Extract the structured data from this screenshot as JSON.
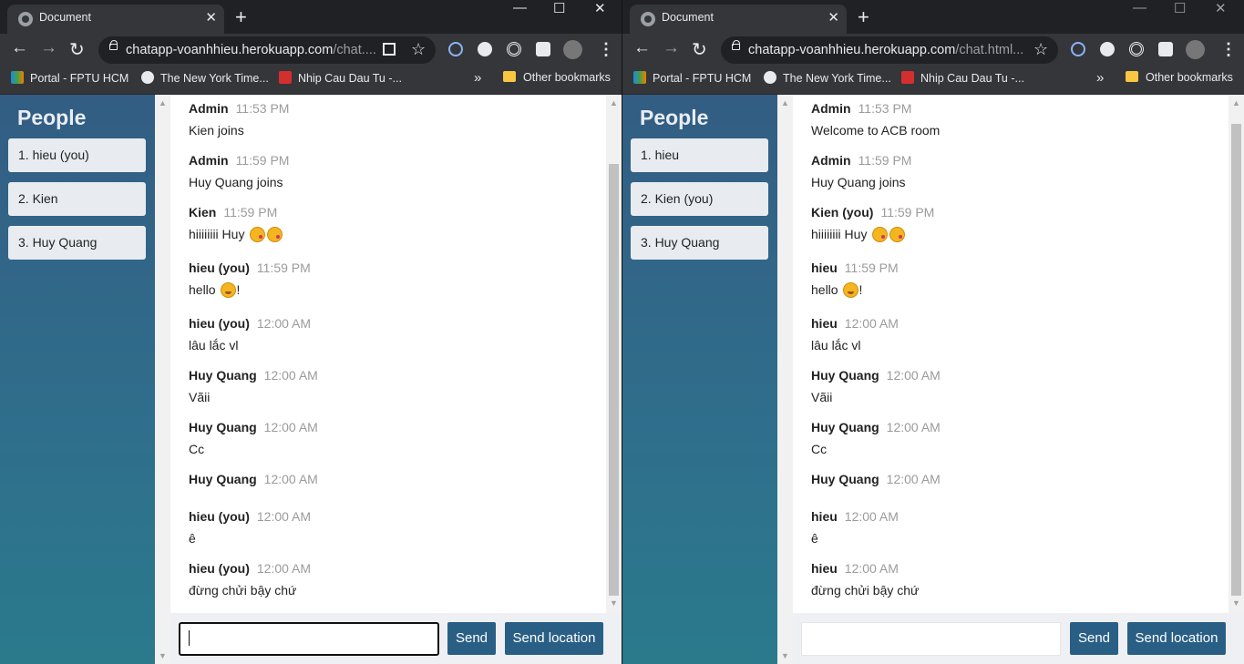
{
  "windows": [
    {
      "tab_title": "Document",
      "url_main": "chatapp-voanhhieu.herokuapp.com",
      "url_rest": "/chat....",
      "bookmarks": [
        "Portal - FPTU HCM",
        "The New York Time...",
        "Nhip Cau Dau Tu -..."
      ],
      "bookmarks_more": "»",
      "other_bookmarks": "Other bookmarks",
      "people_title": "People",
      "users": [
        "1. hieu (you)",
        "2. Kien",
        "3. Huy Quang"
      ],
      "messages": [
        {
          "name": "Admin",
          "time": "11:53 PM",
          "text": "Kien joins",
          "emoji": ""
        },
        {
          "name": "Admin",
          "time": "11:59 PM",
          "text": "Huy Quang joins",
          "emoji": ""
        },
        {
          "name": "Kien",
          "time": "11:59 PM",
          "text": "hiiiiiiii Huy ",
          "emoji": "kiss"
        },
        {
          "name": "hieu (you)",
          "time": "11:59 PM",
          "text": "hello ",
          "emoji": "grin"
        },
        {
          "name": "hieu (you)",
          "time": "12:00 AM",
          "text": "lâu lắc vl",
          "emoji": ""
        },
        {
          "name": "Huy Quang",
          "time": "12:00 AM",
          "text": "Vãii",
          "emoji": ""
        },
        {
          "name": "Huy Quang",
          "time": "12:00 AM",
          "text": "Cc",
          "emoji": ""
        },
        {
          "name": "Huy Quang",
          "time": "12:00 AM",
          "text": "",
          "emoji": ""
        },
        {
          "name": "hieu (you)",
          "time": "12:00 AM",
          "text": "ê",
          "emoji": ""
        },
        {
          "name": "hieu (you)",
          "time": "12:00 AM",
          "text": "đừng chửi bậy chứ",
          "emoji": ""
        }
      ],
      "input_value": "",
      "send_label": "Send",
      "send_location_label": "Send location"
    },
    {
      "tab_title": "Document",
      "url_main": "chatapp-voanhhieu.herokuapp.com",
      "url_rest": "/chat.html...",
      "bookmarks": [
        "Portal - FPTU HCM",
        "The New York Time...",
        "Nhip Cau Dau Tu -..."
      ],
      "bookmarks_more": "»",
      "other_bookmarks": "Other bookmarks",
      "people_title": "People",
      "users": [
        "1. hieu",
        "2. Kien (you)",
        "3. Huy Quang"
      ],
      "messages": [
        {
          "name": "Admin",
          "time": "11:53 PM",
          "text": "Welcome to ACB room",
          "emoji": ""
        },
        {
          "name": "Admin",
          "time": "11:59 PM",
          "text": "Huy Quang joins",
          "emoji": ""
        },
        {
          "name": "Kien (you)",
          "time": "11:59 PM",
          "text": "hiiiiiiii Huy ",
          "emoji": "kiss"
        },
        {
          "name": "hieu",
          "time": "11:59 PM",
          "text": "hello ",
          "emoji": "grin"
        },
        {
          "name": "hieu",
          "time": "12:00 AM",
          "text": "lâu lắc vl",
          "emoji": ""
        },
        {
          "name": "Huy Quang",
          "time": "12:00 AM",
          "text": "Vãii",
          "emoji": ""
        },
        {
          "name": "Huy Quang",
          "time": "12:00 AM",
          "text": "Cc",
          "emoji": ""
        },
        {
          "name": "Huy Quang",
          "time": "12:00 AM",
          "text": "",
          "emoji": ""
        },
        {
          "name": "hieu",
          "time": "12:00 AM",
          "text": "ê",
          "emoji": ""
        },
        {
          "name": "hieu",
          "time": "12:00 AM",
          "text": "đừng chửi bậy chứ",
          "emoji": ""
        }
      ],
      "input_value": "",
      "send_label": "Send",
      "send_location_label": "Send location"
    }
  ]
}
